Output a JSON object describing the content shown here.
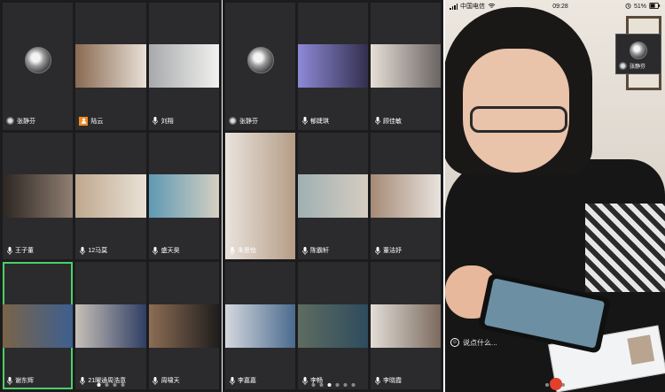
{
  "pages": [
    {
      "tiles": [
        {
          "name": "张静芬",
          "video": false,
          "icon": "mic",
          "video_colors": [
            "#2b2b2e",
            "#2b2b2e"
          ],
          "active": false
        },
        {
          "name": "陆云",
          "video": true,
          "icon": "user",
          "video_colors": [
            "#8a6a52",
            "#e8e0d7"
          ],
          "active": false
        },
        {
          "name": "刘翔",
          "video": true,
          "icon": "mic",
          "video_colors": [
            "#a7a9ab",
            "#f1f1ef"
          ],
          "active": false
        },
        {
          "name": "王子董",
          "video": true,
          "icon": "mic",
          "video_colors": [
            "#2d2622",
            "#8f7e72"
          ],
          "active": false
        },
        {
          "name": "12马莫",
          "video": true,
          "icon": "mic",
          "video_colors": [
            "#bfa88f",
            "#e9e1d5"
          ],
          "active": false
        },
        {
          "name": "盛天昊",
          "video": true,
          "icon": "mic",
          "video_colors": [
            "#5e9ab4",
            "#d5cfc2"
          ],
          "active": false
        },
        {
          "name": "谢东辉",
          "video": true,
          "icon": "mic",
          "video_colors": [
            "#7a6449",
            "#3d5f8f"
          ],
          "active": true
        },
        {
          "name": "21曜通周浩意",
          "video": true,
          "icon": "mic",
          "video_colors": [
            "#c7c0b8",
            "#2f3e64"
          ],
          "active": false
        },
        {
          "name": "周啸天",
          "video": true,
          "icon": "mic",
          "video_colors": [
            "#8d6d55",
            "#1f1d1c"
          ],
          "active": false
        }
      ],
      "page_dots": 4,
      "current_dot": 1
    },
    {
      "tiles": [
        {
          "name": "张静芬",
          "video": false,
          "icon": "mic",
          "video_colors": [
            "#2b2b2e",
            "#2b2b2e"
          ],
          "active": false
        },
        {
          "name": "郁婕琪",
          "video": true,
          "icon": "mic",
          "video_colors": [
            "#8d89d6",
            "#332f4f"
          ],
          "active": false
        },
        {
          "name": "顾佳敏",
          "video": true,
          "icon": "mic",
          "video_colors": [
            "#e6dfd6",
            "#6a6462"
          ],
          "active": false
        },
        {
          "name": "朱思怡",
          "video": true,
          "icon": "mic",
          "video_colors": [
            "#e9e3dc",
            "#b59d86"
          ],
          "active": true
        },
        {
          "name": "陈霸轩",
          "video": true,
          "icon": "mic",
          "video_colors": [
            "#9fb0b2",
            "#d6cdc1"
          ],
          "active": false
        },
        {
          "name": "董洁妤",
          "video": true,
          "icon": "mic",
          "video_colors": [
            "#a58a76",
            "#e8e3de"
          ],
          "active": false
        },
        {
          "name": "李嘉嘉",
          "video": true,
          "icon": "mic",
          "video_colors": [
            "#d4d8de",
            "#4a6a8e"
          ],
          "active": false
        },
        {
          "name": "李畅",
          "video": true,
          "icon": "mic",
          "video_colors": [
            "#5e6c60",
            "#2e4b5e"
          ],
          "active": false
        },
        {
          "name": "李晓霞",
          "video": true,
          "icon": "mic",
          "video_colors": [
            "#e2ddd6",
            "#7b6a5e"
          ],
          "active": false
        }
      ],
      "page_dots": 6,
      "current_dot": 3
    }
  ],
  "phone": {
    "status_bar": {
      "carrier": "中国电信",
      "wifi": "wifi-icon",
      "time": "09:28",
      "battery": "51%"
    },
    "pip": {
      "name": "张静芬"
    },
    "comment_placeholder": "说点什么...",
    "page_dots": 3,
    "current_dot": 2
  },
  "colors": {
    "active_outline": "#4bd06a",
    "panel_bg": "#1c1c1e",
    "tile_bg": "#2b2b2e",
    "user_badge": "#f08a24"
  }
}
